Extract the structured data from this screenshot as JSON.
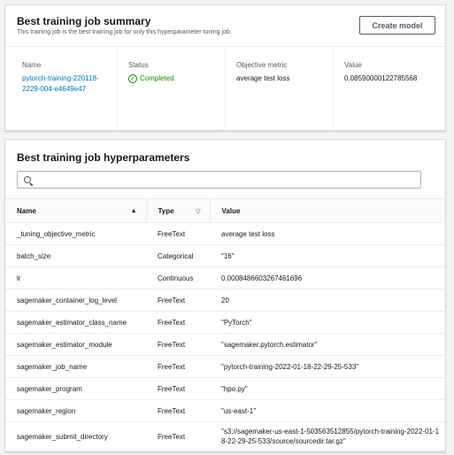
{
  "summary": {
    "title": "Best training job summary",
    "description": "This training job is the best training job for only this hyperparameter tuning job.",
    "create_model_label": "Create model",
    "name_label": "Name",
    "name_value": "pytorch-training-220118-2229-004-e4649e47",
    "status_label": "Status",
    "status_value": "Completed",
    "metric_label": "Objective metric",
    "metric_value": "average test loss",
    "value_label": "Value",
    "value_value": "0.08590000122785568"
  },
  "hyperparameters": {
    "title": "Best training job hyperparameters",
    "search_placeholder": "",
    "columns": {
      "name": "Name",
      "type": "Type",
      "value": "Value"
    },
    "rows": [
      {
        "name": "_tuning_objective_metric",
        "type": "FreeText",
        "value": "average test loss"
      },
      {
        "name": "batch_size",
        "type": "Categorical",
        "value": "\"16\""
      },
      {
        "name": "lr",
        "type": "Continuous",
        "value": "0.0008486603267461696"
      },
      {
        "name": "sagemaker_container_log_level",
        "type": "FreeText",
        "value": "20"
      },
      {
        "name": "sagemaker_estimator_class_name",
        "type": "FreeText",
        "value": "\"PyTorch\""
      },
      {
        "name": "sagemaker_estimator_module",
        "type": "FreeText",
        "value": "\"sagemaker.pytorch.estimator\""
      },
      {
        "name": "sagemaker_job_name",
        "type": "FreeText",
        "value": "\"pytorch-training-2022-01-18-22-29-25-533\""
      },
      {
        "name": "sagemaker_program",
        "type": "FreeText",
        "value": "\"hpo.py\""
      },
      {
        "name": "sagemaker_region",
        "type": "FreeText",
        "value": "\"us-east-1\""
      },
      {
        "name": "sagemaker_submit_directory",
        "type": "FreeText",
        "value": "\"s3://sagemaker-us-east-1-503563512855/pytorch-training-2022-01-18-22-29-25-533/source/sourcedir.tar.gz\""
      }
    ]
  }
}
